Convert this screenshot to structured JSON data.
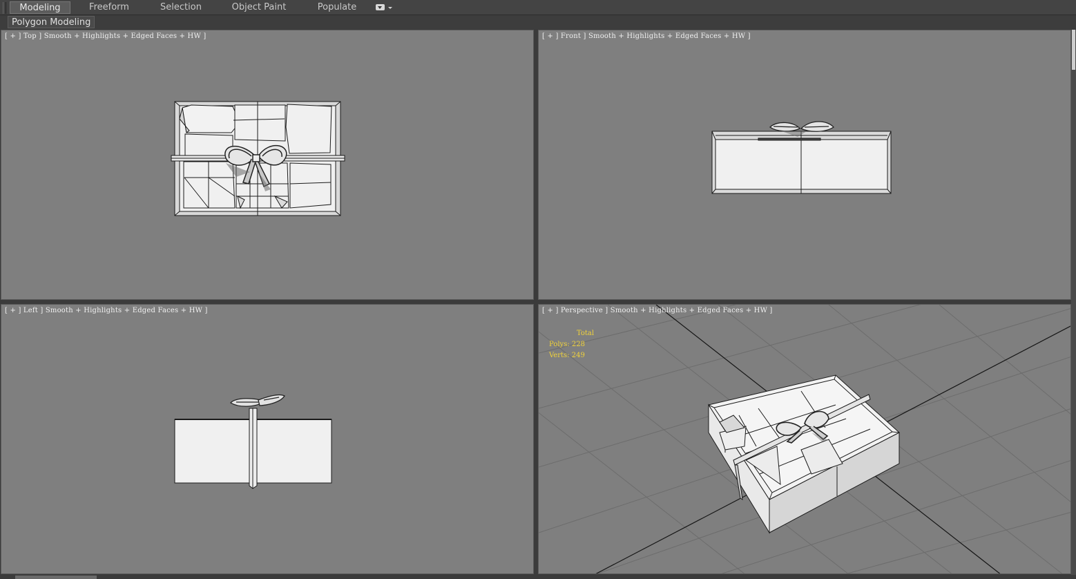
{
  "ribbon": {
    "tabs": [
      {
        "label": "Modeling",
        "active": true
      },
      {
        "label": "Freeform",
        "active": false
      },
      {
        "label": "Selection",
        "active": false
      },
      {
        "label": "Object Paint",
        "active": false
      },
      {
        "label": "Populate",
        "active": false
      }
    ],
    "more_icon": "dropdown-icon",
    "panel_label": "Polygon Modeling"
  },
  "viewports": {
    "top": {
      "label": "[ + ] Top ] Smooth + Highlights + Edged Faces + HW ]"
    },
    "front": {
      "label": "[ + ] Front ] Smooth + Highlights + Edged Faces + HW ]"
    },
    "left": {
      "label": "[ + ] Left ] Smooth + Highlights + Edged Faces + HW ]"
    },
    "perspective": {
      "label": "[ + ] Perspective ] Smooth + Highlights + Edged Faces + HW ]"
    }
  },
  "stats": {
    "header": "Total",
    "polys_label": "Polys:",
    "polys_value": "228",
    "verts_label": "Verts:",
    "verts_value": "249"
  },
  "colors": {
    "viewport_bg": "#7f7f7f",
    "stats_text": "#f2d33a",
    "active_tab": "#5c5c5c"
  }
}
